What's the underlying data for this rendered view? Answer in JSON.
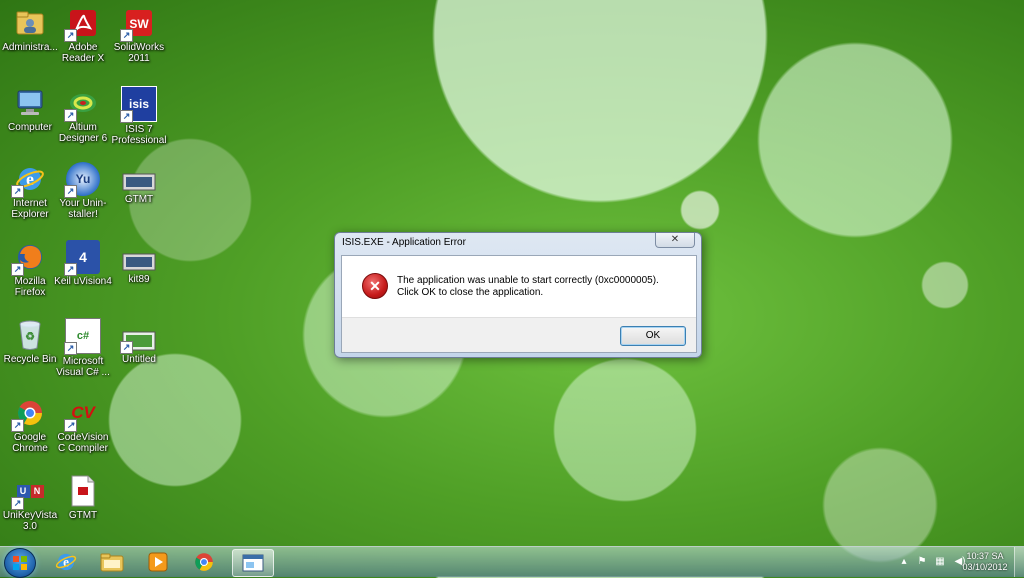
{
  "desktop": {
    "icons": [
      {
        "label": "Administra...",
        "icon": "user-folder-icon"
      },
      {
        "label": "Adobe Reader X",
        "icon": "adobe-reader-icon"
      },
      {
        "label": "SolidWorks 2011",
        "icon": "solidworks-icon"
      },
      {
        "label": "Computer",
        "icon": "computer-icon"
      },
      {
        "label": "Altium Designer 6",
        "icon": "altium-icon"
      },
      {
        "label": "ISIS 7 Professional",
        "icon": "isis-icon",
        "glyph": "isis"
      },
      {
        "label": "Internet Explorer",
        "icon": "internet-explorer-icon"
      },
      {
        "label": "Your Unin-staller!",
        "icon": "uninstaller-icon",
        "glyph": "Yu"
      },
      {
        "label": "GTMT",
        "icon": "gtmt-icon"
      },
      {
        "label": "Mozilla Firefox",
        "icon": "firefox-icon"
      },
      {
        "label": "Keil uVision4",
        "icon": "keil-icon",
        "glyph": "4"
      },
      {
        "label": "kit89",
        "icon": "kit89-icon"
      },
      {
        "label": "Recycle Bin",
        "icon": "recycle-bin-icon"
      },
      {
        "label": "Microsoft Visual C# ...",
        "icon": "visual-csharp-icon",
        "glyph": "c#"
      },
      {
        "label": "Untitled",
        "icon": "untitled-icon"
      },
      {
        "label": "Google Chrome",
        "icon": "chrome-icon"
      },
      {
        "label": "CodeVision C Compiler",
        "icon": "codevision-icon",
        "glyph": "CV"
      },
      {
        "label": "UniKeyVista 3.0",
        "icon": "unikey-icon",
        "glyph": "U N"
      },
      {
        "label": "GTMT",
        "icon": "gtmt-pdf-icon"
      }
    ]
  },
  "dialog": {
    "title": "ISIS.EXE - Application Error",
    "close_glyph": "✕",
    "message": "The application was unable to start correctly (0xc0000005). Click OK to close the application.",
    "error_glyph": "✕",
    "ok_label": "OK"
  },
  "taskbar": {
    "pinned": [
      {
        "icon": "internet-explorer-icon"
      },
      {
        "icon": "file-explorer-icon"
      },
      {
        "icon": "media-player-icon"
      },
      {
        "icon": "chrome-icon"
      },
      {
        "icon": "isis-window-icon",
        "active": true
      }
    ],
    "tray": [
      {
        "icon": "tray-expand-icon",
        "glyph": "▴"
      },
      {
        "icon": "action-center-icon",
        "glyph": "⚑"
      },
      {
        "icon": "network-icon",
        "glyph": "▦"
      },
      {
        "icon": "volume-icon",
        "glyph": "◀)"
      }
    ],
    "clock_time": "10:37 SA",
    "clock_date": "03/10/2012"
  }
}
